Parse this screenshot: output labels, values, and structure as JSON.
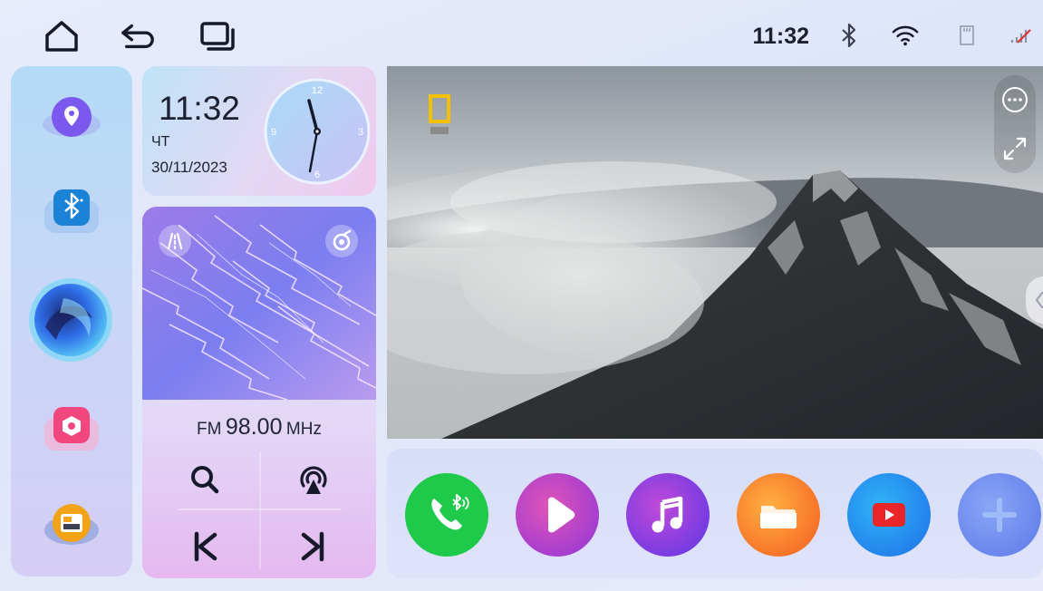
{
  "status_bar": {
    "time": "11:32",
    "nav_icons": [
      "home-icon",
      "back-icon",
      "recent-apps-icon"
    ],
    "status_icons": [
      "bluetooth-icon",
      "wifi-icon",
      "sd-card-icon",
      "cellular-no-signal-icon"
    ]
  },
  "dock": {
    "items": [
      "navigation-app",
      "bluetooth-app",
      "voice-assistant",
      "settings-app",
      "split-screen-app"
    ]
  },
  "clock_widget": {
    "time": "11:32",
    "day": "ЧТ",
    "date": "30/11/2023",
    "dial_labels": [
      "12",
      "3",
      "6",
      "9"
    ]
  },
  "radio_widget": {
    "band": "FM",
    "frequency": "98.00",
    "unit": "MHz",
    "controls": [
      "search-icon",
      "radio-signal-icon",
      "prev-icon",
      "next-icon"
    ]
  },
  "video": {
    "controls": [
      "more-options-icon",
      "fullscreen-icon"
    ]
  },
  "apps": [
    {
      "name": "bluetooth-phone",
      "color": "#1fc94a"
    },
    {
      "name": "video-player",
      "color": "#b84dd6"
    },
    {
      "name": "music",
      "color": "#8b3fe6"
    },
    {
      "name": "files",
      "color": "#fb7a2b"
    },
    {
      "name": "youtube",
      "color": "#1e8cf0"
    },
    {
      "name": "add-app",
      "color": "#6a8cf0"
    }
  ]
}
